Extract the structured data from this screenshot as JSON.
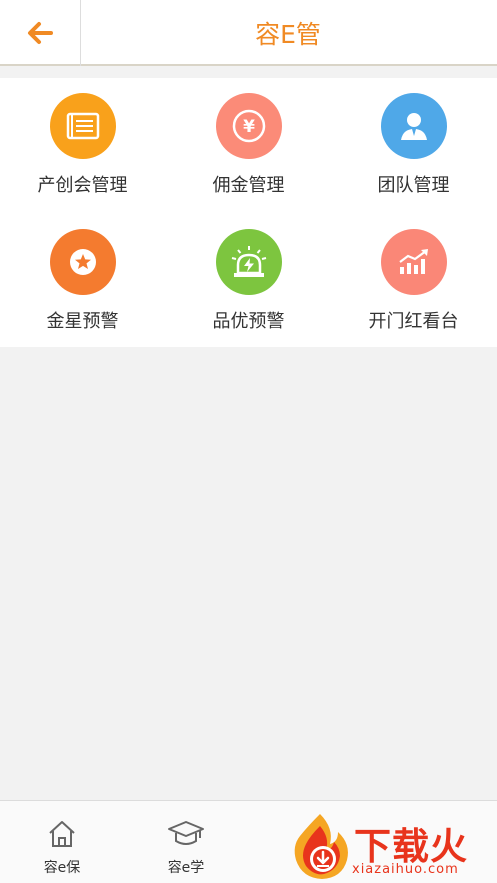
{
  "header": {
    "title": "容E管"
  },
  "grid": {
    "items": [
      {
        "label": "产创会管理",
        "icon": "list-board-icon",
        "color": "#f9a11b"
      },
      {
        "label": "佣金管理",
        "icon": "yen-coin-icon",
        "color": "#fb8b78"
      },
      {
        "label": "团队管理",
        "icon": "team-person-icon",
        "color": "#4fa8e8"
      },
      {
        "label": "金星预警",
        "icon": "star-icon",
        "color": "#f47b2f"
      },
      {
        "label": "品优预警",
        "icon": "alarm-light-icon",
        "color": "#7dc53f"
      },
      {
        "label": "开门红看台",
        "icon": "growth-chart-icon",
        "color": "#fa8777"
      }
    ]
  },
  "bottom_nav": {
    "items": [
      {
        "label": "容e保",
        "icon": "home-icon"
      },
      {
        "label": "容e学",
        "icon": "graduation-cap-icon"
      }
    ]
  },
  "watermark": {
    "text": "下载火",
    "url": "xiazaihuo.com"
  },
  "colors": {
    "accent": "#f08a24",
    "page_bg": "#f2f2f2",
    "watermark_red": "#e8341c"
  }
}
